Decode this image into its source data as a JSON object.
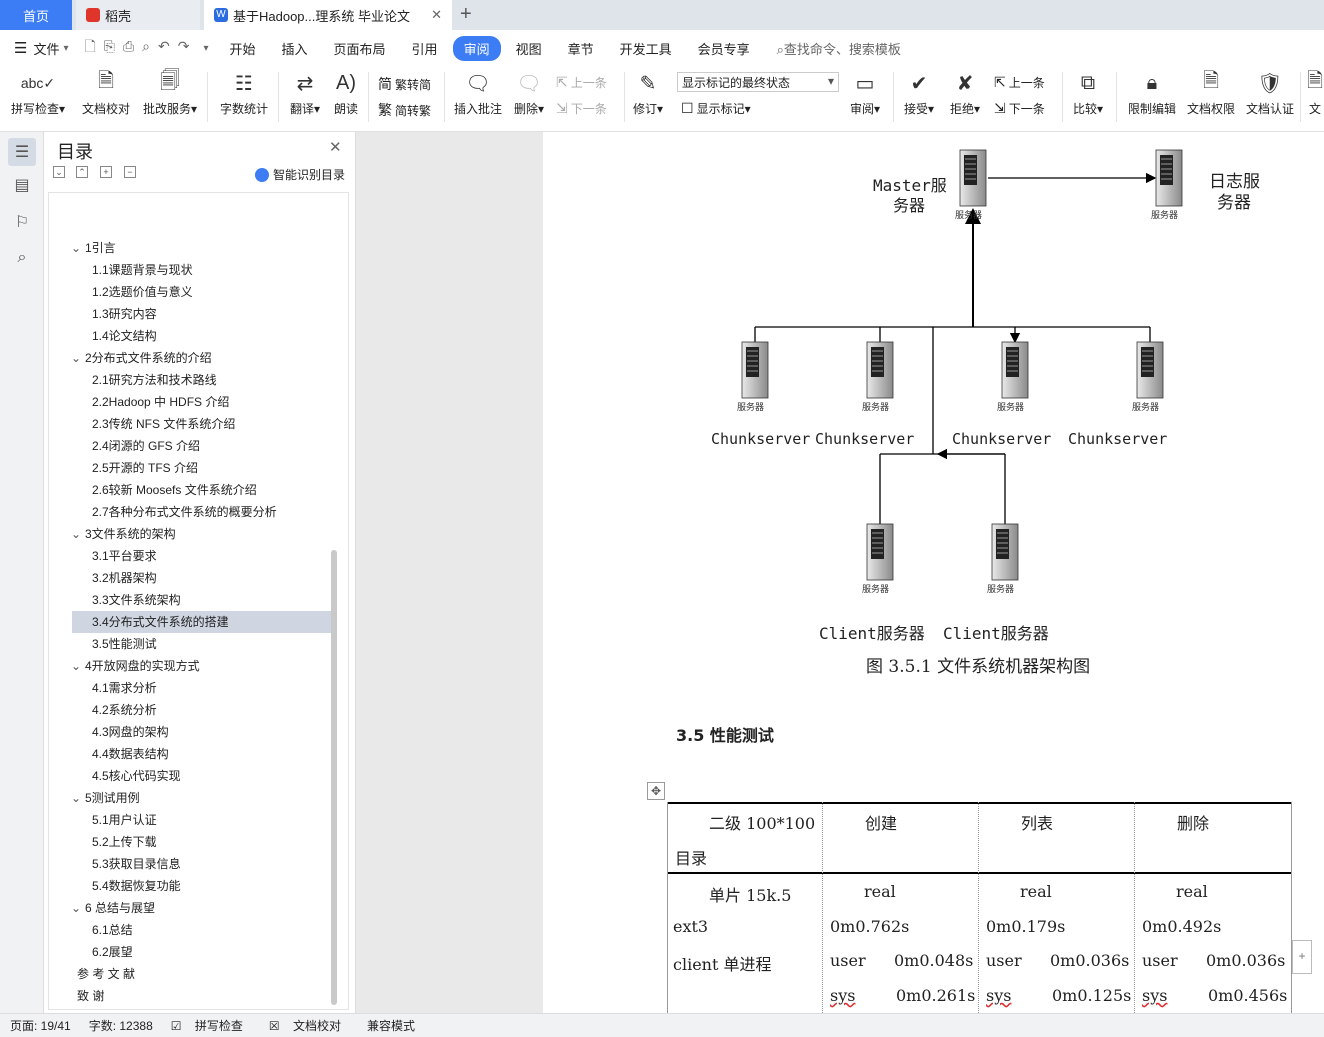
{
  "tabs": {
    "home": "首页",
    "daoke": "稻壳",
    "doc": "基于Hadoop...理系统 毕业论文"
  },
  "menu": {
    "file": "文件",
    "items": [
      "开始",
      "插入",
      "页面布局",
      "引用",
      "审阅",
      "视图",
      "章节",
      "开发工具",
      "会员专享"
    ],
    "active": "审阅",
    "search": "查找命令、搜索模板"
  },
  "ribbon": {
    "spell": "拼写检查",
    "proof": "文档校对",
    "batch": "批改服务",
    "wordcount": "字数统计",
    "translate": "翻译",
    "read": "朗读",
    "to_trad": "繁转简",
    "to_simp": "简转繁",
    "insert_comment": "插入批注",
    "delete": "删除",
    "prev": "上一条",
    "next": "下一条",
    "revise": "修订",
    "markup_state": "显示标记的最终状态",
    "show_markup": "显示标记",
    "review": "审阅",
    "accept": "接受",
    "reject": "拒绝",
    "prev2": "上一条",
    "next2": "下一条",
    "compare": "比较",
    "restrict": "限制编辑",
    "permission": "文档权限",
    "certify": "文档认证",
    "more": "文"
  },
  "toc": {
    "title": "目录",
    "smart": "智能识别目录",
    "items": [
      {
        "t": "1引言",
        "lvl": 1
      },
      {
        "t": "1.1课题背景与现状",
        "lvl": 2
      },
      {
        "t": "1.2选题价值与意义",
        "lvl": 2
      },
      {
        "t": "1.3研究内容",
        "lvl": 2
      },
      {
        "t": "1.4论文结构",
        "lvl": 2
      },
      {
        "t": "2分布式文件系统的介绍",
        "lvl": 1
      },
      {
        "t": "2.1研究方法和技术路线",
        "lvl": 2
      },
      {
        "t": "2.2Hadoop 中 HDFS 介绍",
        "lvl": 2
      },
      {
        "t": "2.3传统 NFS 文件系统介绍",
        "lvl": 2
      },
      {
        "t": "2.4闭源的 GFS 介绍",
        "lvl": 2
      },
      {
        "t": "2.5开源的 TFS 介绍",
        "lvl": 2
      },
      {
        "t": "2.6较新 Moosefs 文件系统介绍",
        "lvl": 2
      },
      {
        "t": "2.7各种分布式文件系统的概要分析",
        "lvl": 2
      },
      {
        "t": "3文件系统的架构",
        "lvl": 1
      },
      {
        "t": "3.1平台要求",
        "lvl": 2
      },
      {
        "t": "3.2机器架构",
        "lvl": 2
      },
      {
        "t": "3.3文件系统架构",
        "lvl": 2
      },
      {
        "t": "3.4分布式文件系统的搭建",
        "lvl": 2,
        "sel": true
      },
      {
        "t": "3.5性能测试",
        "lvl": 2
      },
      {
        "t": "4开放网盘的实现方式",
        "lvl": 1
      },
      {
        "t": "4.1需求分析",
        "lvl": 2
      },
      {
        "t": "4.2系统分析",
        "lvl": 2
      },
      {
        "t": "4.3网盘的架构",
        "lvl": 2
      },
      {
        "t": "4.4数据表结构",
        "lvl": 2
      },
      {
        "t": "4.5核心代码实现",
        "lvl": 2
      },
      {
        "t": "5测试用例",
        "lvl": 1
      },
      {
        "t": "5.1用户认证",
        "lvl": 2
      },
      {
        "t": "5.2上传下载",
        "lvl": 2
      },
      {
        "t": "5.3获取目录信息",
        "lvl": 2
      },
      {
        "t": "5.4数据恢复功能",
        "lvl": 2
      },
      {
        "t": "6 总结与展望",
        "lvl": 1
      },
      {
        "t": "6.1总结",
        "lvl": 2
      },
      {
        "t": "6.2展望",
        "lvl": 2
      },
      {
        "t": "参 考 文 献",
        "lvl": 0
      },
      {
        "t": "致      谢",
        "lvl": 0
      }
    ]
  },
  "diagram": {
    "master": "Master服务器",
    "master_l1": "Master服",
    "master_l2": "务器",
    "log_l1": "日志服",
    "log_l2": "务器",
    "server_tag": "服务器",
    "chunk": "Chunkserver",
    "client": "Client服务器",
    "caption": "图 3.5.1  文件系统机器架构图"
  },
  "section": "3.5  性能测试",
  "table": {
    "headers": [
      "二级 100*100",
      "创建",
      "列表",
      "删除"
    ],
    "header_extra": "目录",
    "row": {
      "c1": [
        "单片 15k.5",
        "ext3",
        "client 单进程"
      ],
      "real": "real",
      "create": {
        "real": "0m0.762s",
        "user": "0m0.048s",
        "sys": "0m0.261s"
      },
      "list": {
        "real": "0m0.179s",
        "user": "0m0.036s",
        "sys": "0m0.125s"
      },
      "delete": {
        "real": "0m0.492s",
        "user": "0m0.036s",
        "sys": "0m0.456s"
      },
      "user_label": "user",
      "sys_label": "sys"
    }
  },
  "status": {
    "page": "页面: 19/41",
    "words": "字数: 12388",
    "spell": "拼写检查",
    "proof": "文档校对",
    "compat": "兼容模式"
  }
}
